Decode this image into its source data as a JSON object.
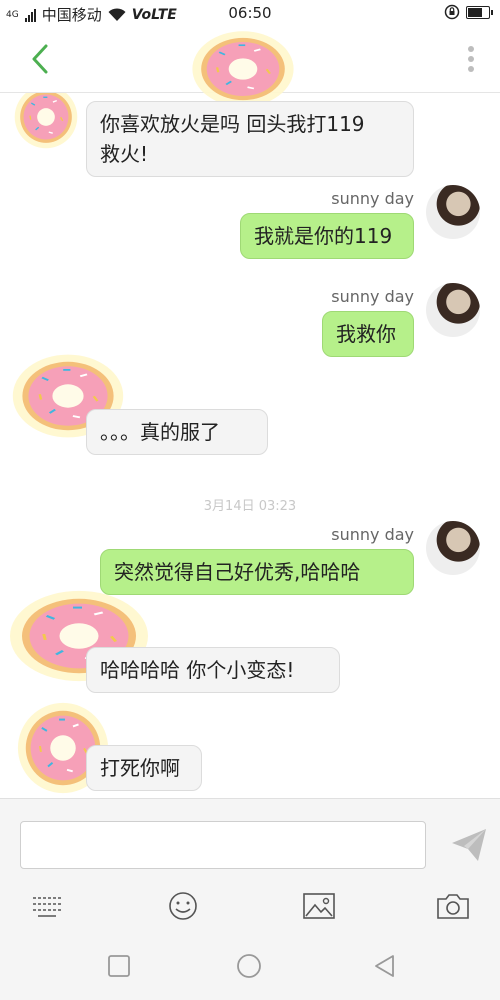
{
  "status_bar": {
    "network_type": "4G",
    "carrier": "中国移动",
    "volte": "VoLTE",
    "time": "06:50"
  },
  "header": {
    "back_icon": "chevron-left-icon",
    "menu_icon": "more-vertical-icon",
    "accent_color": "#4caf50"
  },
  "messages": [
    {
      "side": "in",
      "text_line1": "你喜欢放火是吗 回头我打119",
      "text_line2": "救火!"
    },
    {
      "side": "out",
      "sender": "sunny day",
      "text": "我就是你的119"
    },
    {
      "side": "out",
      "sender": "sunny day",
      "text": "我救你"
    },
    {
      "side": "in",
      "text": "。。。真的服了"
    },
    {
      "side": "out",
      "sender": "sunny day",
      "text": "突然觉得自己好优秀,哈哈哈"
    },
    {
      "side": "in",
      "text": "哈哈哈哈 你个小变态!"
    },
    {
      "side": "in",
      "text": "打死你啊"
    }
  ],
  "timestamp": "3月14日 03:23",
  "input": {
    "value": "",
    "placeholder": "",
    "send_icon": "send-icon"
  },
  "toolbar": {
    "keyboard_icon": "keyboard-icon",
    "emoji_icon": "emoji-icon",
    "image_icon": "image-icon",
    "camera_icon": "camera-icon"
  },
  "nav": {
    "recent_icon": "square-icon",
    "home_icon": "circle-icon",
    "back_icon": "triangle-back-icon"
  }
}
